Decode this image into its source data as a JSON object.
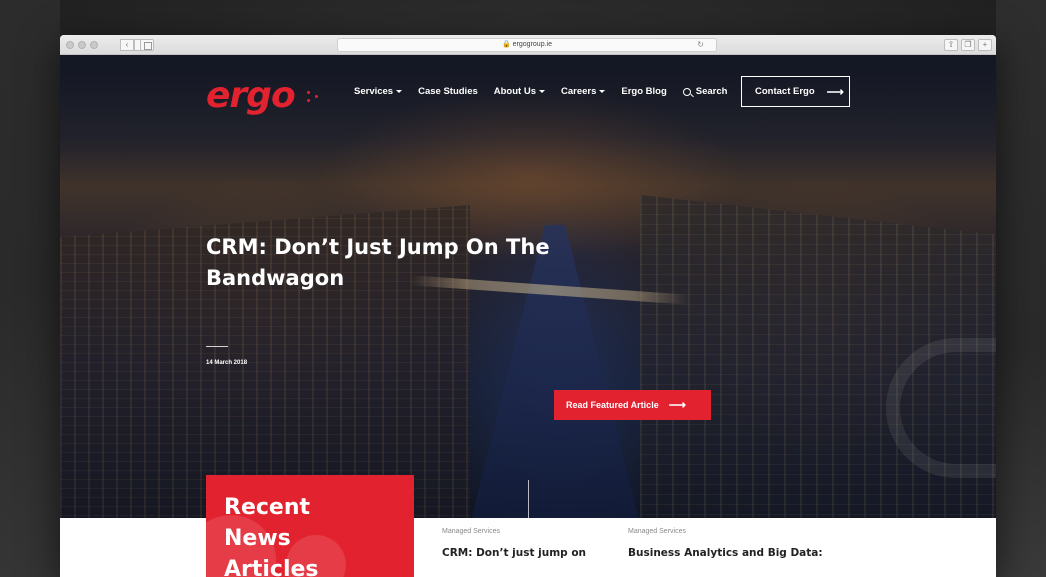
{
  "browser": {
    "url": "ergogroup.ie"
  },
  "site": {
    "logo_text": "ergo",
    "nav": [
      {
        "label": "Services"
      },
      {
        "label": "Case Studies"
      },
      {
        "label": "About Us"
      },
      {
        "label": "Careers"
      },
      {
        "label": "Ergo Blog"
      },
      {
        "label": "Search"
      }
    ],
    "contact_label": "Contact Ergo",
    "brand_color": "#e2222f"
  },
  "hero": {
    "headline_line1": "CRM: Don’t Just Jump On The",
    "headline_line2": "Bandwagon",
    "date": "14 March 2018",
    "cta_label": "Read Featured Article"
  },
  "news": {
    "card_title_line1": "Recent",
    "card_title_line2": "News",
    "card_title_line3": "Articles",
    "items": [
      {
        "category": "Managed Services",
        "title": "CRM: Don’t just jump on"
      },
      {
        "category": "Managed Services",
        "title": "Business Analytics and Big Data:"
      }
    ]
  }
}
